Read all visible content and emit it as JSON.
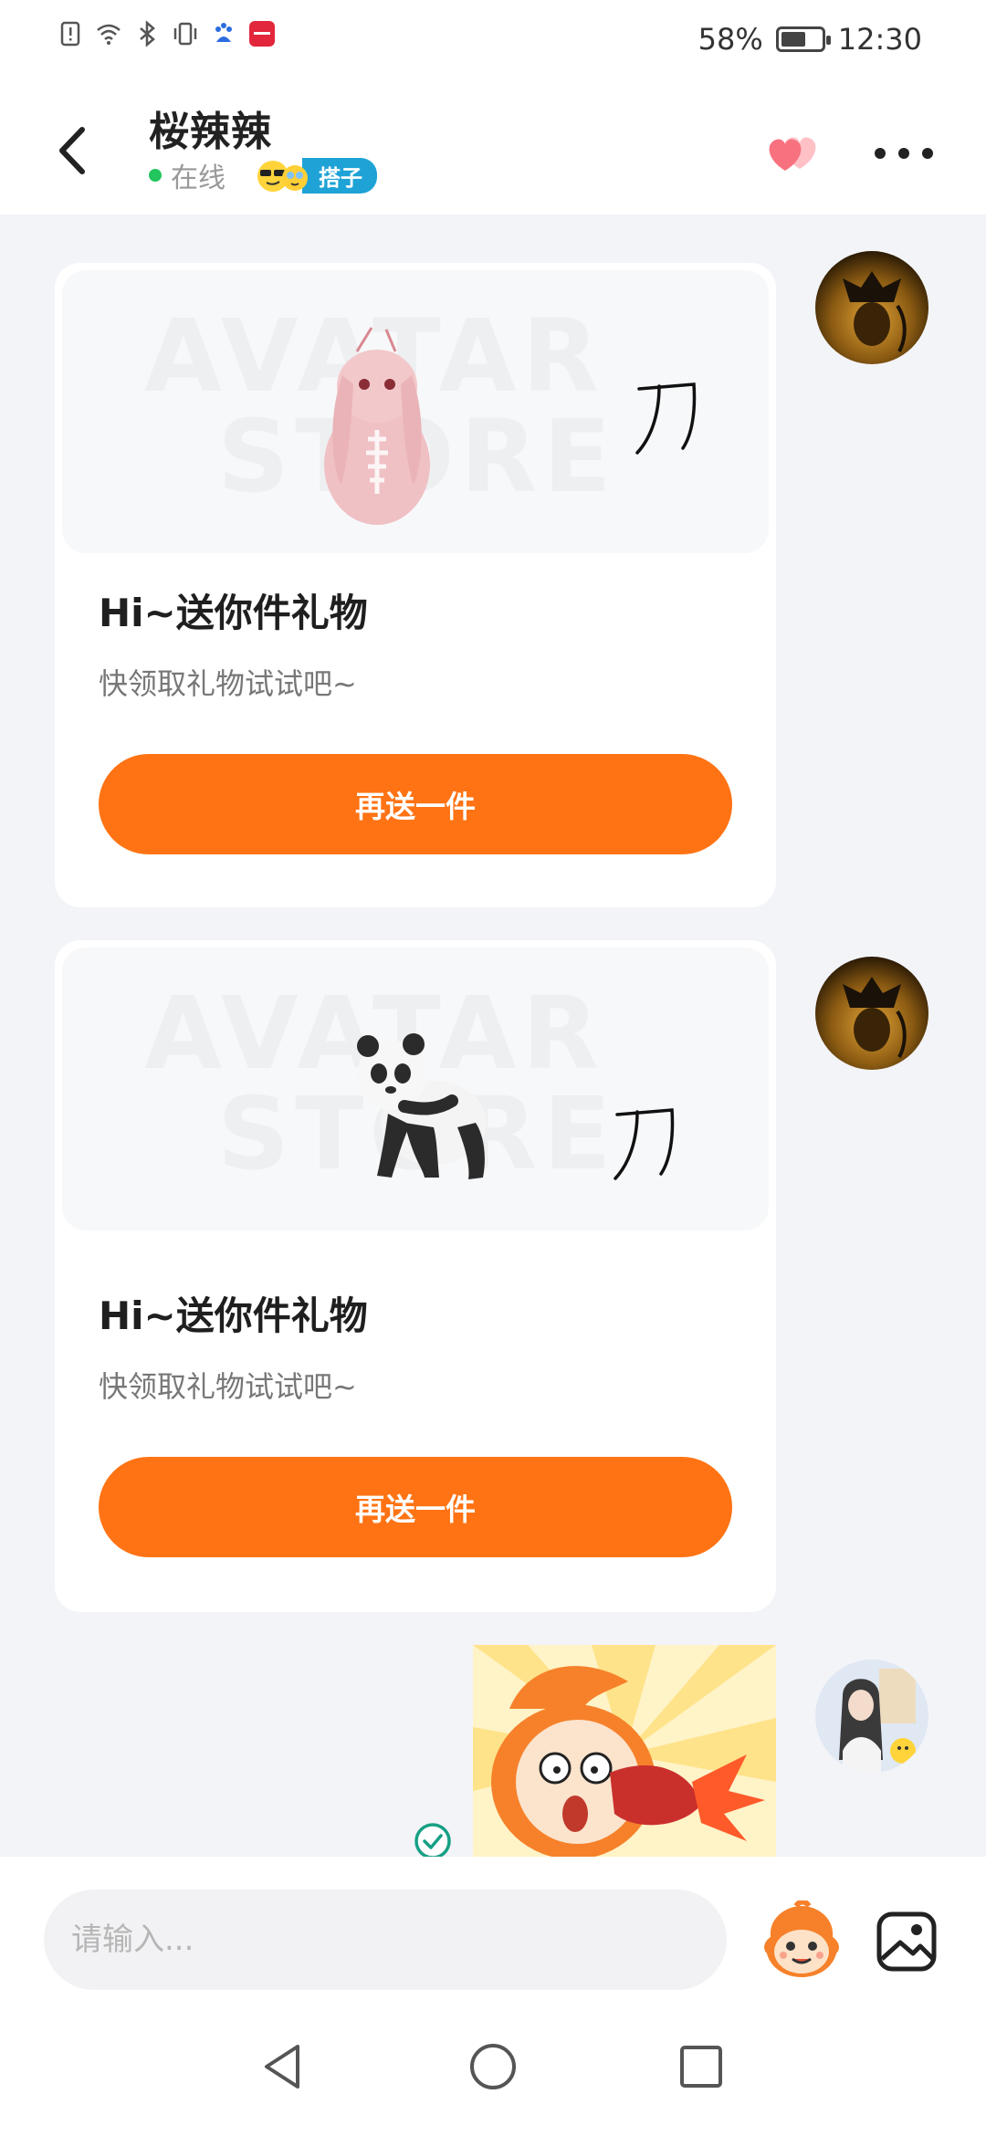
{
  "status_bar": {
    "battery": "58%",
    "battery_level": 0.58,
    "time": "12:30",
    "icons": [
      "notification-icon",
      "wifi-icon",
      "bluetooth-icon",
      "vibrate-icon",
      "baidu-icon",
      "xiaohongshu-app-icon"
    ]
  },
  "header": {
    "title": "桜辣辣",
    "status": "在线",
    "badge": "搭子",
    "accent": "#ff7314"
  },
  "messages": [
    {
      "type": "gift",
      "gift": "bunny-plush-image",
      "watermark_top": "AVATAR",
      "watermark_bottom": "STORE",
      "handwriting": "刀",
      "title": "Hi~送你件礼物",
      "subtitle": "快领取礼物试试吧~",
      "button": "再送一件"
    },
    {
      "type": "gift",
      "gift": "panda-image",
      "watermark_top": "AVATAR",
      "watermark_bottom": "STORE",
      "handwriting": "刀",
      "title": "Hi~送你件礼物",
      "subtitle": "快领取礼物试试吧~",
      "button": "再送一件"
    },
    {
      "type": "sticker",
      "sticker": "cartoon-punch-sticker",
      "read": true
    }
  ],
  "input": {
    "placeholder": "请输入..."
  },
  "colors": {
    "button": "#ff7314",
    "online": "#22c55e",
    "badge": "#1fa3d6"
  }
}
